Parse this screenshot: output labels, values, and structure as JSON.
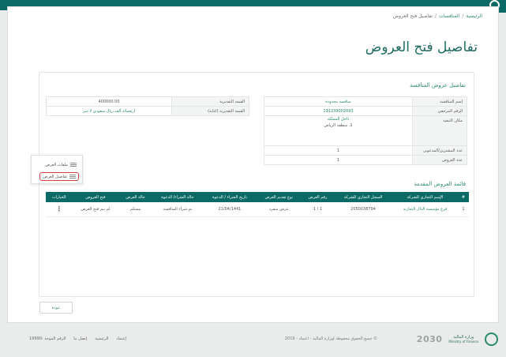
{
  "breadcrumb": {
    "home": "الرئيسية",
    "tenders": "المنافسات",
    "current": "تفاصيل فتح العروض",
    "separator": "/"
  },
  "page_title": "تفاصيل فتح العروض",
  "tender_details": {
    "section_title": "تفاصيل عروض المنافسة",
    "left": [
      {
        "label": "القيمة التقديرية",
        "value": "400000.00"
      },
      {
        "label": "القيمة التقديرية (كتابة)",
        "value": "أربعمائة ألف ريال سعودي لا غير"
      }
    ],
    "right": [
      {
        "label": "إسم المنافسة",
        "value": "منافسة محدودة"
      },
      {
        "label": "الرقم المرجعي",
        "value": "191239002093"
      },
      {
        "label": "مكان التنفيذ",
        "value_line1": "داخل المملكة",
        "value_line2": "1. منطقة الرياض"
      },
      {
        "label": "عدد المشترين/المدعوين",
        "value": "1"
      },
      {
        "label": "عدد العروض",
        "value": "1"
      }
    ]
  },
  "offers": {
    "section_title": "قائمة العروض المقدمة",
    "headers": [
      "#",
      "الإسم التجاري للشركة",
      "السجل التجاري للشركة",
      "رقم العرض",
      "نوع تقديم العرض",
      "تاريخ الشراء / الدعوة",
      "حالة الشراء/ الدعوة",
      "حالة العرض",
      "فتح العروض",
      "الخيارات"
    ],
    "rows": [
      {
        "num": "1",
        "company": "فرع مؤسسة الدال التجارية",
        "cr": "2050038794",
        "offer_no": "1 / 1",
        "type": "عرض منفرد",
        "date": "21/04/1441",
        "purchase_status": "تم شراء المنافسة",
        "offer_status": "مستلم",
        "opening": "لم يتم فتح العرض",
        "options": "⋮"
      }
    ]
  },
  "dropdown": {
    "files": "ملفات العرض",
    "details": "تفاصيل العرض"
  },
  "back_button": "عودة",
  "footer": {
    "copyright": "© جميع الحقوق محفوظة لوزارة المالية - اعتماد - 2019",
    "links": [
      "إعتماد",
      "الرئيسية",
      "إتصل بنا",
      "الرقم الموحد :19990"
    ],
    "vision": "2030",
    "ministry_ar": "وزارة المالية",
    "ministry_en": "Ministry of Finance"
  },
  "colors": {
    "primary": "#0c6a66",
    "accent": "#2a8a6a",
    "highlight": "#d94040"
  }
}
